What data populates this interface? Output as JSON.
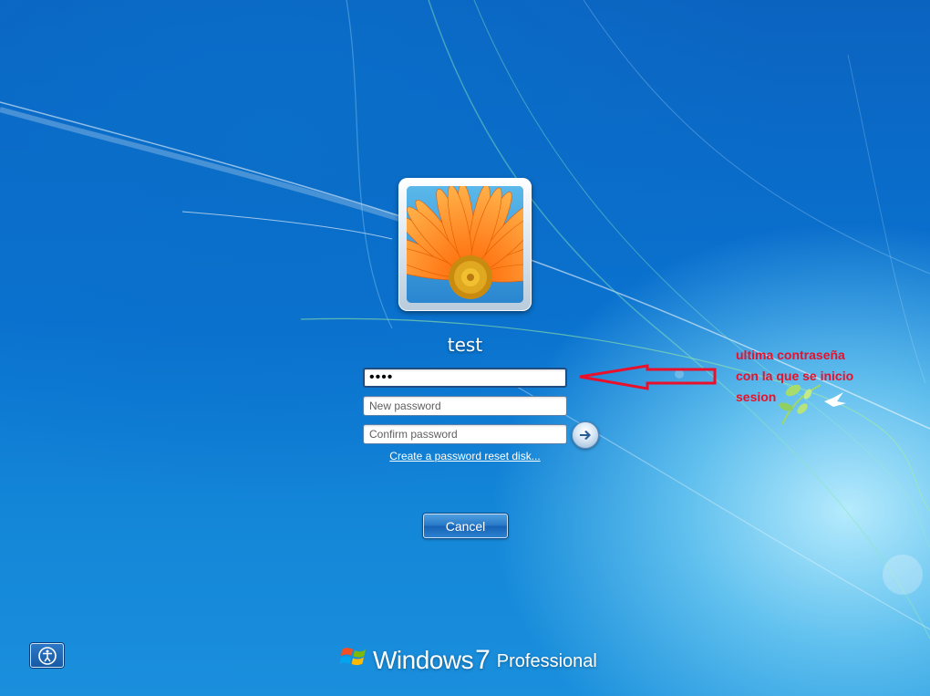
{
  "user": {
    "name": "test"
  },
  "fields": {
    "old_password_value": "••••",
    "new_password_placeholder": "New password",
    "confirm_password_placeholder": "Confirm password"
  },
  "links": {
    "reset_disk": "Create a password reset disk..."
  },
  "buttons": {
    "cancel": "Cancel"
  },
  "annotation": {
    "lines": [
      "ultima contraseña",
      "con la que se inicio",
      "sesion"
    ],
    "color": "#e8102a"
  },
  "branding": {
    "product": "Windows",
    "version": "7",
    "edition": "Professional"
  },
  "icons": {
    "submit": "arrow-right-icon",
    "ease_of_access": "ease-of-access-icon",
    "logo": "windows-logo-icon"
  }
}
